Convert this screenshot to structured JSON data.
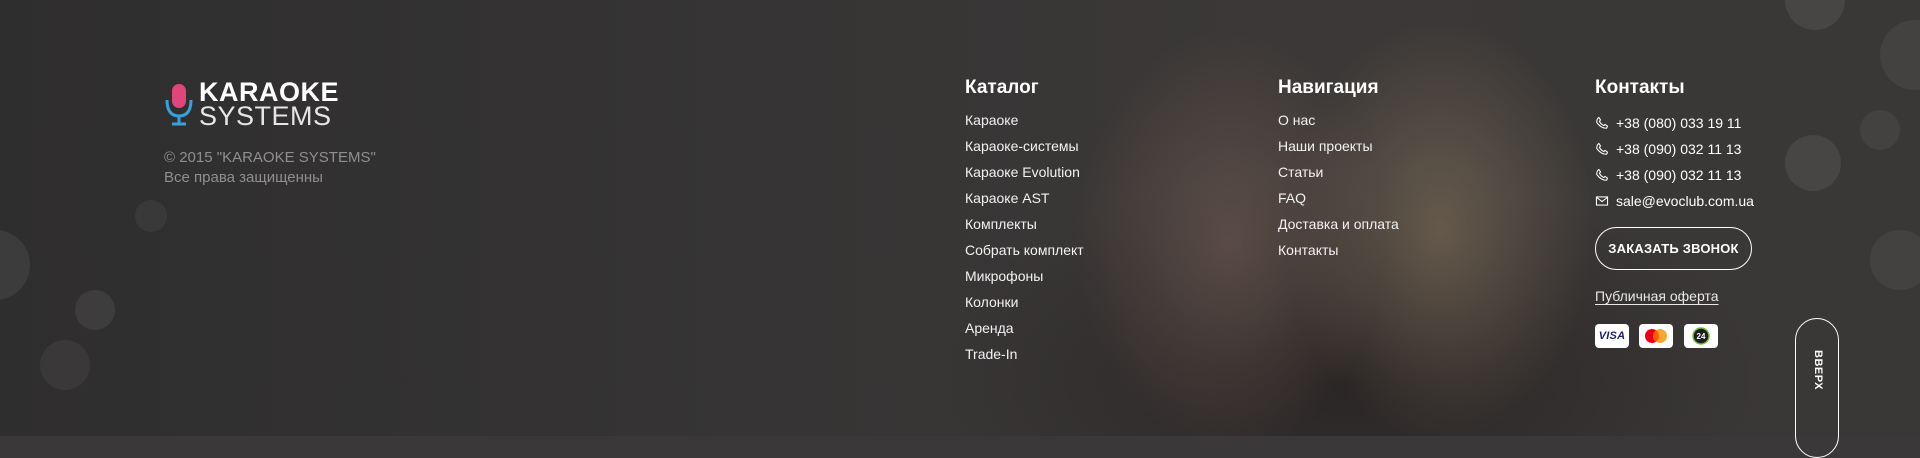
{
  "brand": {
    "name_line1": "KARAOKE",
    "name_line2": "SYSTEMS",
    "copyright_line1": "© 2015 \"KARAOKE SYSTEMS\"",
    "copyright_line2": "Все права защищенны",
    "accent_pink": "#e0457b",
    "accent_blue": "#3aa0d9"
  },
  "catalog": {
    "title": "Каталог",
    "items": [
      "Караоке",
      "Караоке-системы",
      "Караоке Evolution",
      "Караоке AST",
      "Комплекты",
      "Собрать комплект",
      "Микрофоны",
      "Колонки",
      "Аренда",
      "Trade-In"
    ]
  },
  "navigation": {
    "title": "Навигация",
    "items": [
      "О нас",
      "Наши проекты",
      "Статьи",
      "FAQ",
      "Доставка и оплата",
      "Контакты"
    ]
  },
  "contacts": {
    "title": "Контакты",
    "phones": [
      "+38 (080) 033 19 11",
      "+38 (090) 032 11 13",
      "+38 (090) 032 11 13"
    ],
    "email": "sale@evoclub.com.ua",
    "phone_icon": "phone-icon",
    "mail_icon": "mail-icon",
    "call_button": "ЗАКАЗАТЬ ЗВОНОК",
    "offer_link": "Публичная оферта"
  },
  "payments": {
    "visa": "VISA",
    "mastercard_icon": "mastercard-icon",
    "privat24": "24"
  },
  "scroll_up": "ВВЕРХ"
}
